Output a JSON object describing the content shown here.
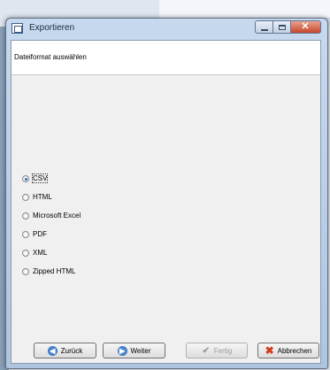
{
  "window": {
    "title": "Exportieren"
  },
  "header": {
    "subtitle": "Dateiformat auswählen"
  },
  "options": [
    {
      "label": "CSV",
      "selected": true
    },
    {
      "label": "HTML",
      "selected": false
    },
    {
      "label": "Microsoft Excel",
      "selected": false
    },
    {
      "label": "PDF",
      "selected": false
    },
    {
      "label": "XML",
      "selected": false
    },
    {
      "label": "Zipped HTML",
      "selected": false
    }
  ],
  "buttons": {
    "back": "Zurück",
    "next": "Weiter",
    "finish": "Fertig",
    "cancel": "Abbrechen"
  },
  "icons": {
    "back": "arrow-left-icon",
    "next": "arrow-right-icon",
    "finish": "checkmark-icon",
    "cancel": "x-icon"
  },
  "colors": {
    "accent": "#2b6fc7",
    "cancel": "#d23c1a"
  }
}
